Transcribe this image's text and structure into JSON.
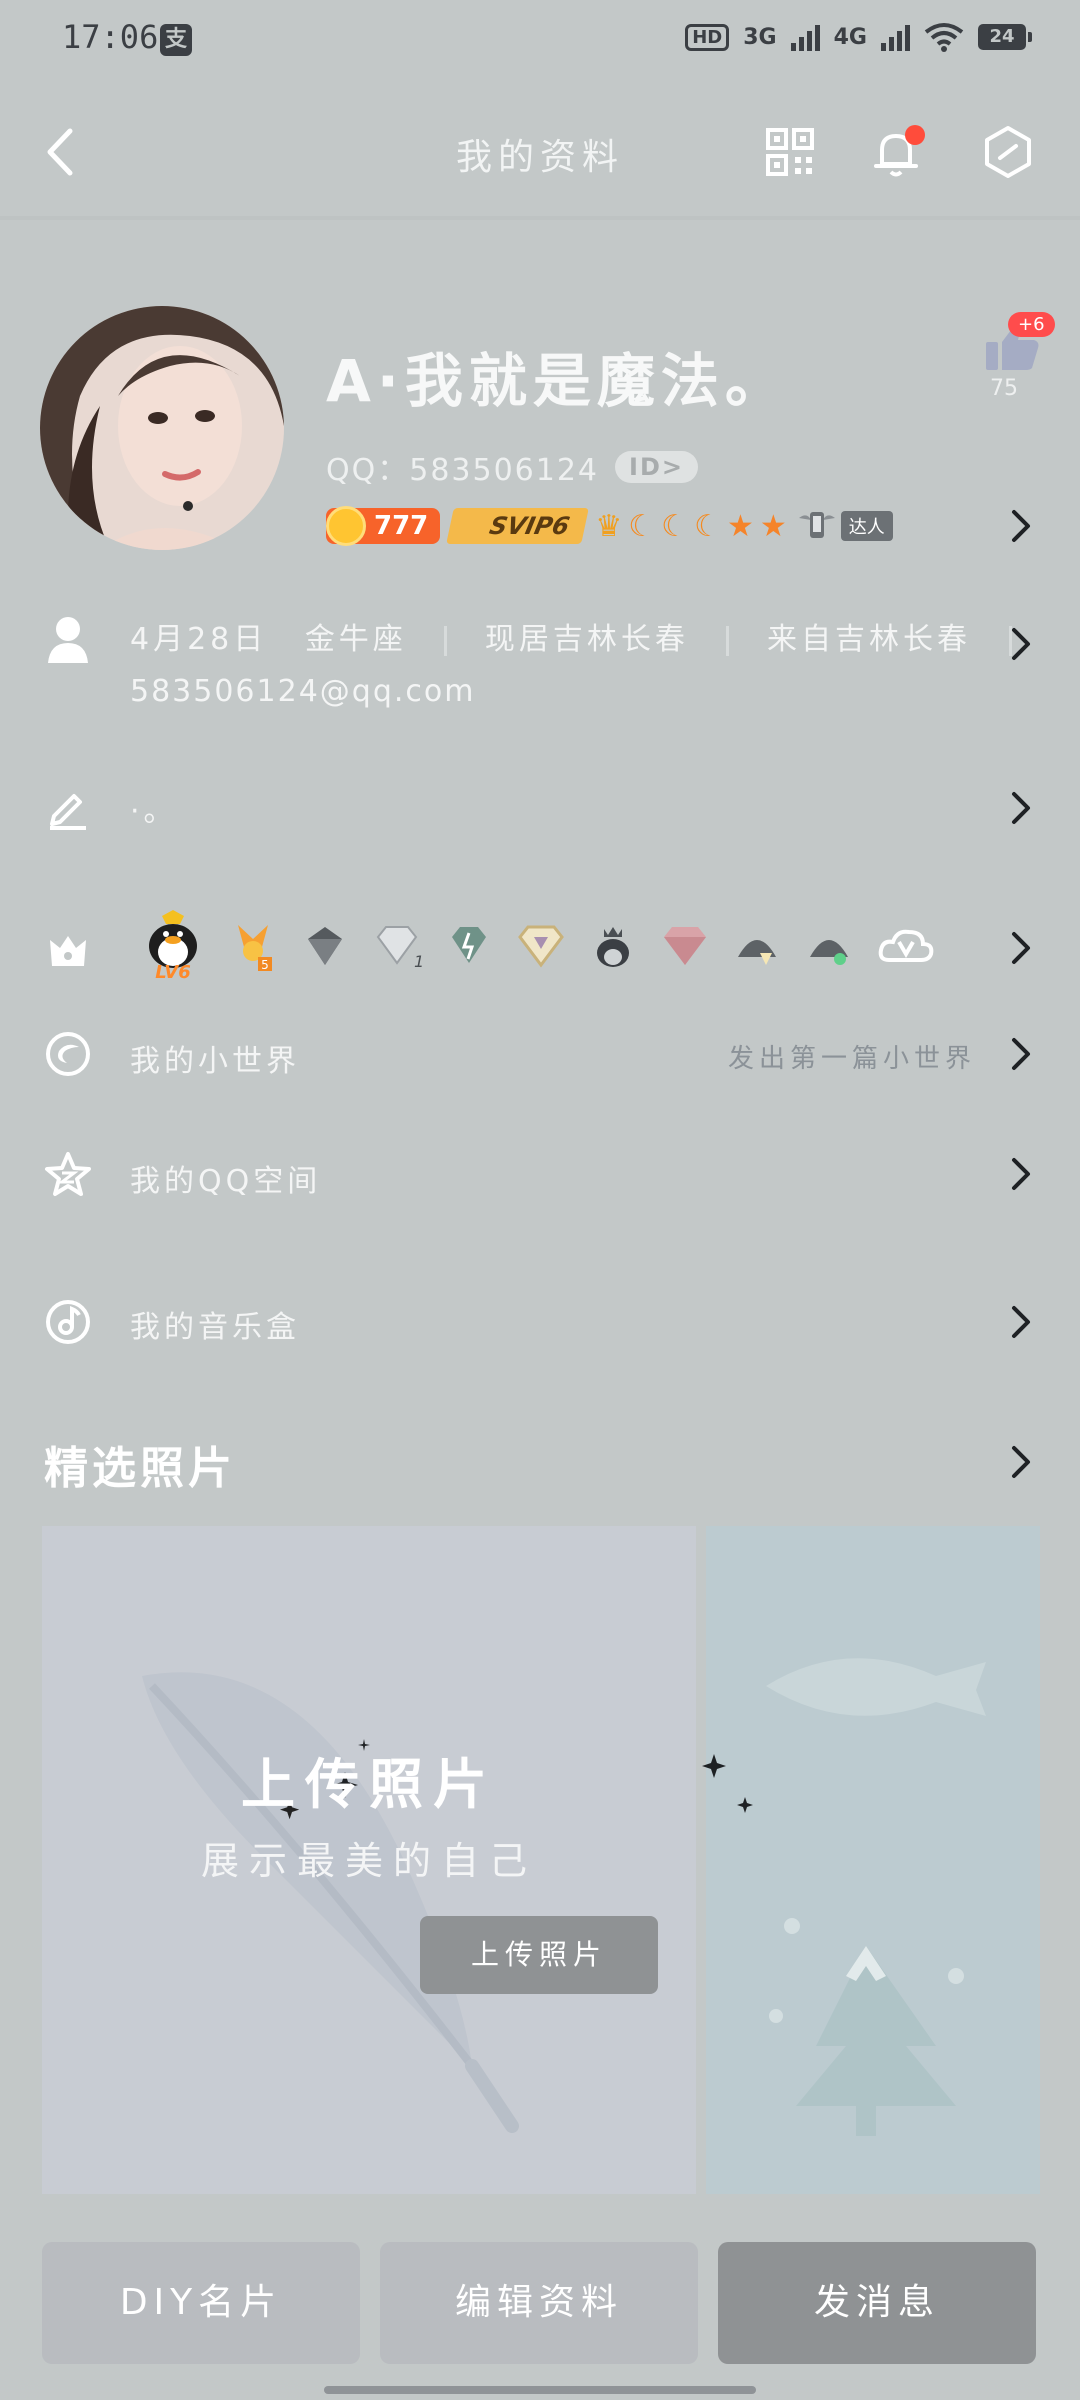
{
  "status": {
    "time": "17:06",
    "app_glyph": "支",
    "hd_label": "HD",
    "net1": "3G",
    "net2": "4G",
    "battery": "24"
  },
  "header": {
    "title": "我的资料"
  },
  "profile": {
    "nickname": "A·我就是魔法。",
    "qq_label": "QQ：583506124",
    "id_badge": "ID>",
    "like_badge": "+6",
    "like_count": "75",
    "coin_value": "777",
    "svip_label": "SVIP6",
    "daren_label": "达人"
  },
  "info": {
    "birthday": "4月28日",
    "zodiac": "金牛座",
    "current_city": "现居吉林长春",
    "hometown": "来自吉林长春",
    "email": "583506124@qq.com"
  },
  "signature": {
    "text": "·。"
  },
  "honors": {
    "level_label": "LV6",
    "num5": "5",
    "num1": "1"
  },
  "rows": {
    "world_label": "我的小世界",
    "world_hint": "发出第一篇小世界",
    "qzone_label": "我的QQ空间",
    "music_label": "我的音乐盒"
  },
  "photos": {
    "section_title": "精选照片",
    "upload_title": "上传照片",
    "upload_subtitle": "展示最美的自己",
    "upload_button": "上传照片"
  },
  "bottom": {
    "diy_label": "DIY名片",
    "edit_label": "编辑资料",
    "message_label": "发消息"
  },
  "colors": {
    "background": "#c3c8c8",
    "notify_dot": "#ff4c3b",
    "coin_orange": "#f7632a",
    "svip_gold": "#f4b94a",
    "primary_button": "#8f9294"
  }
}
